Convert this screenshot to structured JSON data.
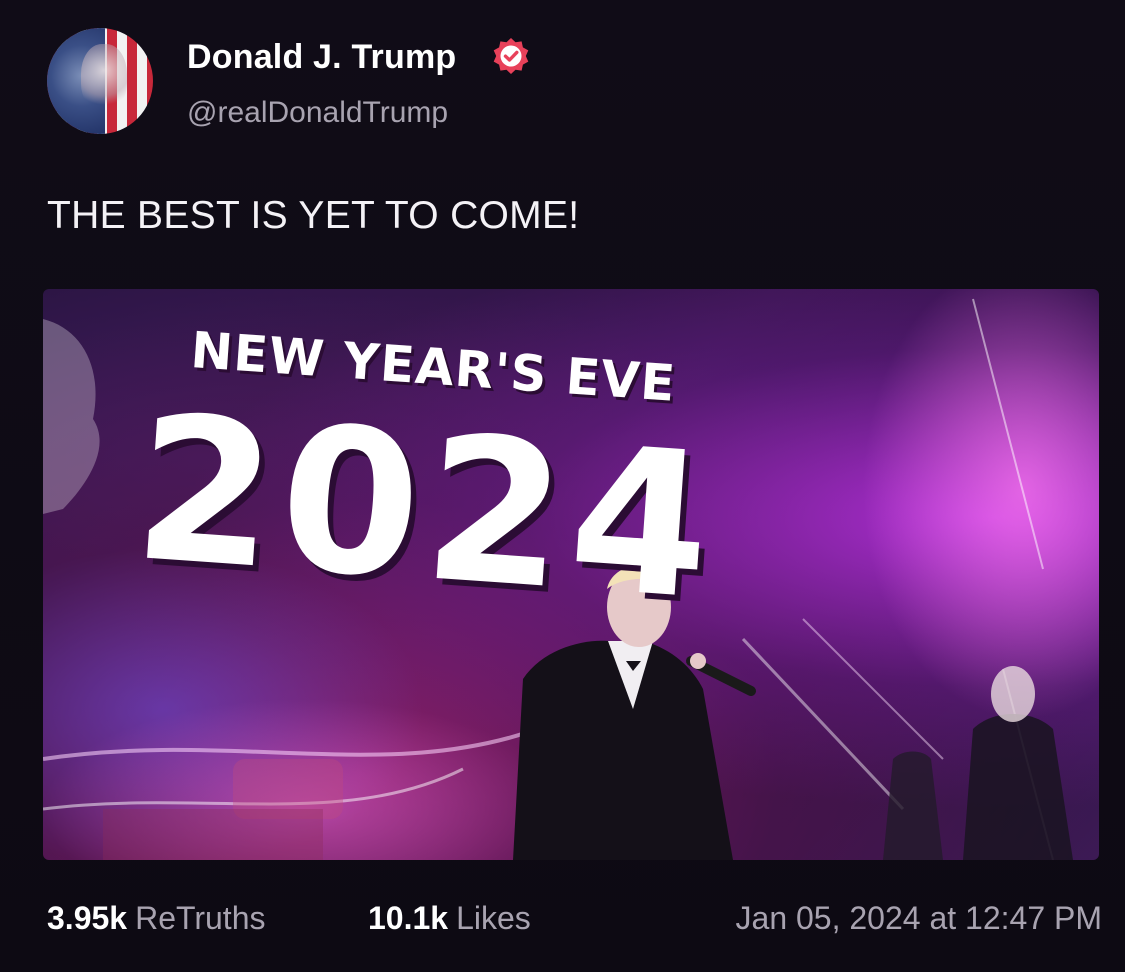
{
  "author": {
    "display_name": "Donald J. Trump",
    "handle": "@realDonaldTrump",
    "verified": true
  },
  "post": {
    "text": "THE BEST IS YET TO COME!",
    "media": {
      "kind": "video",
      "overlay_title": "NEW YEAR'S EVE",
      "overlay_year": "2024"
    }
  },
  "stats": {
    "retruths_count": "3.95k",
    "retruths_label": "ReTruths",
    "likes_count": "10.1k",
    "likes_label": "Likes"
  },
  "timestamp": "Jan 05, 2024 at 12:47 PM",
  "colors": {
    "background": "#0e0b14",
    "secondary_text": "#a8a3b0",
    "verified_badge": "#e8415a",
    "media_accent": "#b12fd6"
  },
  "icons": {
    "verified": "verified-badge-icon"
  }
}
